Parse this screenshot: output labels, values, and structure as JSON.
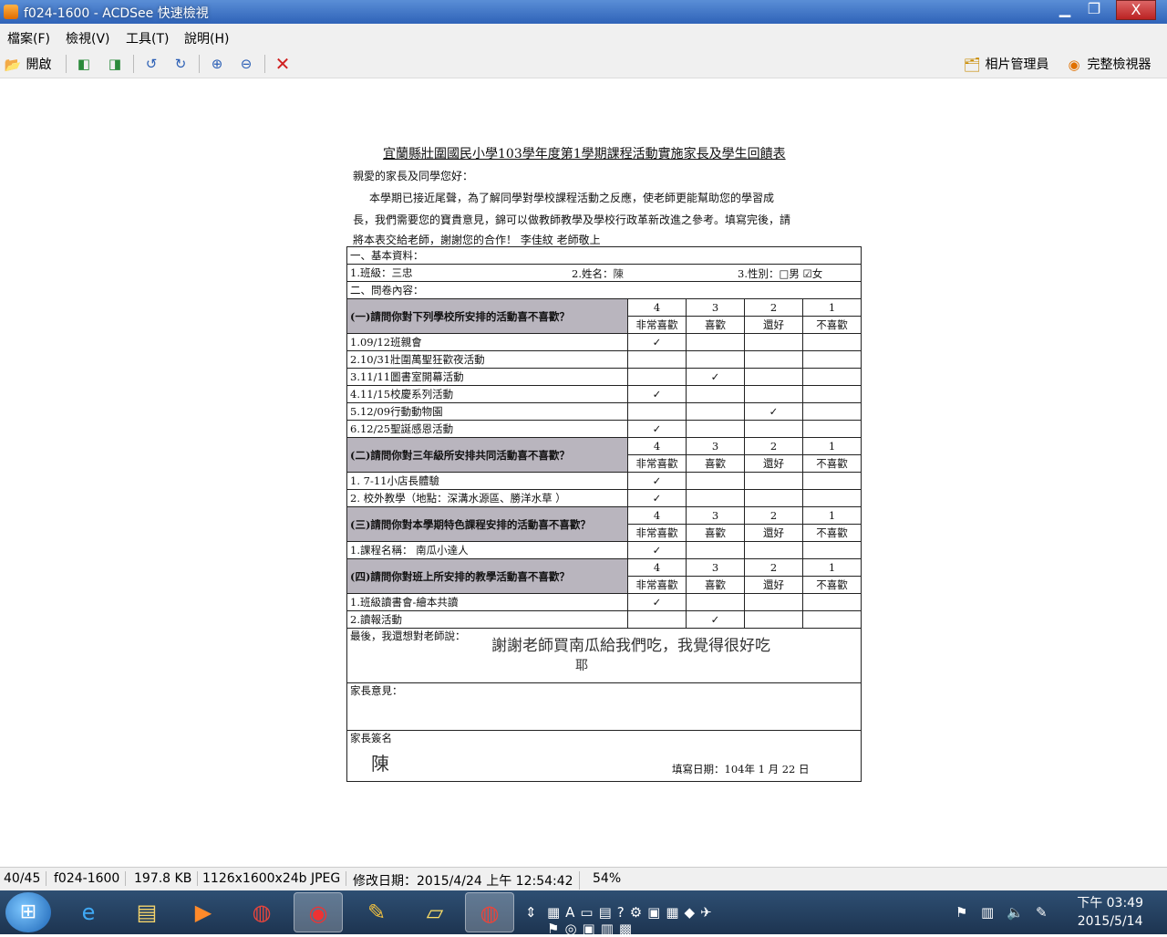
{
  "window": {
    "title": "f024-1600 - ACDSee 快速檢視",
    "min": "▁",
    "max": "❐",
    "close": "X"
  },
  "menu": [
    "檔案(F)",
    "檢視(V)",
    "工具(T)",
    "說明(H)"
  ],
  "toolbar": {
    "open": "開啟",
    "photo_manager": "相片管理員",
    "full_viewer": "完整檢視器"
  },
  "doc": {
    "title": "宜蘭縣壯圍國民小學103學年度第1學期課程活動實施家長及學生回饋表",
    "greeting": "親愛的家長及同學您好：",
    "para1": "本學期已接近尾聲，為了解同學對學校課程活動之反應，使老師更能幫助您的學習成",
    "para2": "長，我們需要您的寶貴意見，錦可以做教師教學及學校行政革新改進之參考。填寫完後，請",
    "para3": "將本表交給老師，謝謝您的合作！      李佳紋 老師敬上",
    "basic": "一、基本資料：",
    "class": "1.班級：三忠",
    "name": "2.姓名：",
    "name_hand": "陳",
    "gender": "3.性別：□男 ☑女",
    "survey": "二、問卷內容：",
    "scale": [
      "4",
      "3",
      "2",
      "1"
    ],
    "scale_labels": [
      "非常喜歡",
      "喜歡",
      "還好",
      "不喜歡"
    ],
    "sec1": "(一)請問你對下列學校所安排的活動喜不喜歡？",
    "sec1_items": [
      "1.09/12班親會",
      "2.10/31壯圍萬聖狂歡夜活動",
      "3.11/11圖書室開幕活動",
      "4.11/15校慶系列活動",
      "5.12/09行動動物園",
      "6.12/25聖誕感恩活動"
    ],
    "sec1_checks": [
      0,
      -1,
      1,
      0,
      2,
      0
    ],
    "sec2": "(二)請問你對三年級所安排共同活動喜不喜歡？",
    "sec2_items": [
      "1. 7-11小店長體驗",
      "2. 校外教學（地點：深溝水源區、勝洋水草 ）"
    ],
    "sec2_checks": [
      0,
      0
    ],
    "sec3": "(三)請問你對本學期特色課程安排的活動喜不喜歡？",
    "sec3_items": [
      "1.課程名稱： 南瓜小達人"
    ],
    "sec3_checks": [
      0
    ],
    "sec4": "(四)請問你對班上所安排的教學活動喜不喜歡？",
    "sec4_items": [
      "1.班級讀書會-繪本共讀",
      "2.讀報活動"
    ],
    "sec4_checks": [
      0,
      1
    ],
    "check": "✓",
    "last": "最後，我還想對老師說：",
    "last_hand": "謝謝老師買南瓜給我們吃，我覺得很好吃",
    "last_hand2": "耶",
    "parent_opinion": "家長意見：",
    "parent_sign": "家長簽名",
    "sign_hand": "陳",
    "fill_date": "填寫日期：104年 1 月 22 日"
  },
  "status": {
    "index": "40/45",
    "name": "f024-1600",
    "size": "197.8 KB",
    "dims": "1126x1600x24b JPEG",
    "modified": "修改日期：2015/4/24 上午 12:54:42",
    "zoom": "54%"
  },
  "clock": {
    "time": "下午 03:49",
    "date": "2015/5/14"
  }
}
